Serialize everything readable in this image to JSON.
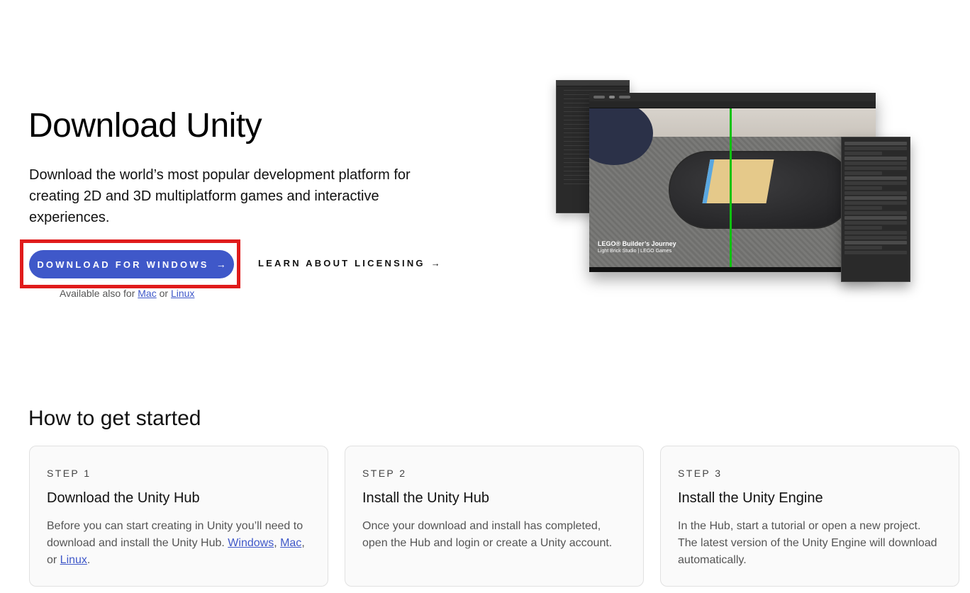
{
  "hero": {
    "title": "Download Unity",
    "subtitle": "Download the world’s most popular development platform for creating 2D and 3D multiplatform games and interactive experiences.",
    "download_button": "DOWNLOAD FOR WINDOWS",
    "licensing_link": "LEARN ABOUT LICENSING",
    "available_prefix": "Available also for",
    "available_mac": "Mac",
    "available_or": "or",
    "available_linux": "Linux"
  },
  "screenshot": {
    "caption_title": "LEGO® Builder’s Journey",
    "caption_sub": "Light Brick Studio | LEGO Games"
  },
  "how_to": {
    "title": "How to get started",
    "steps": [
      {
        "step": "STEP 1",
        "heading": "Download the Unity Hub",
        "desc_text": "Before you can start creating in Unity you’ll need to download and install the Unity Hub.",
        "link_windows": "Windows",
        "link_mac": "Mac",
        "link_linux": "Linux"
      },
      {
        "step": "STEP 2",
        "heading": "Install the Unity Hub",
        "desc_text": "Once your download and install has completed, open the Hub and login or create a Unity account."
      },
      {
        "step": "STEP 3",
        "heading": "Install the Unity Engine",
        "desc_text": "In the Hub, start a tutorial or open a new project. The latest version of the Unity Engine will download automatically."
      }
    ]
  },
  "colors": {
    "accent": "#3f58c9",
    "highlight": "#e01b1b"
  }
}
